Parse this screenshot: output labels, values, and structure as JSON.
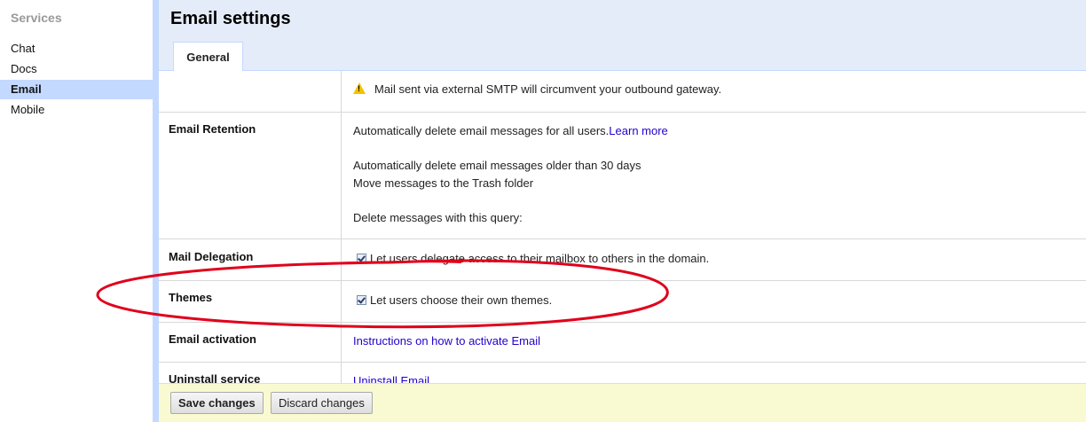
{
  "sidebar": {
    "title": "Services",
    "items": [
      {
        "label": "Chat"
      },
      {
        "label": "Docs"
      },
      {
        "label": "Email"
      },
      {
        "label": "Mobile"
      }
    ]
  },
  "header": {
    "title": "Email settings",
    "tabs": [
      {
        "label": "General"
      }
    ]
  },
  "rows": {
    "smtp_warning": "Mail sent via external SMTP will circumvent your outbound gateway.",
    "retention": {
      "label": "Email Retention",
      "line1": "Automatically delete email messages for all users.",
      "learn_more": "Learn more",
      "line2": "Automatically delete email messages older than 30 days",
      "line3": "Move messages to the Trash folder",
      "line4": "Delete messages with this query:"
    },
    "delegation": {
      "label": "Mail Delegation",
      "checkbox_label": "Let users delegate access to their mailbox to others in the domain."
    },
    "themes": {
      "label": "Themes",
      "checkbox_label": "Let users choose their own themes."
    },
    "activation": {
      "label": "Email activation",
      "link": "Instructions on how to activate Email"
    },
    "uninstall": {
      "label": "Uninstall service",
      "link": "Uninstall Email"
    }
  },
  "footer": {
    "save_label": "Save changes",
    "discard_label": "Discard changes",
    "background": "#fafad2"
  },
  "colors": {
    "accent": "#c3d9ff",
    "header_bg": "#e5ecf9",
    "link": "#2200cc",
    "annotation": "#e0001b"
  },
  "icons": {
    "warning": "warning-triangle-icon"
  }
}
